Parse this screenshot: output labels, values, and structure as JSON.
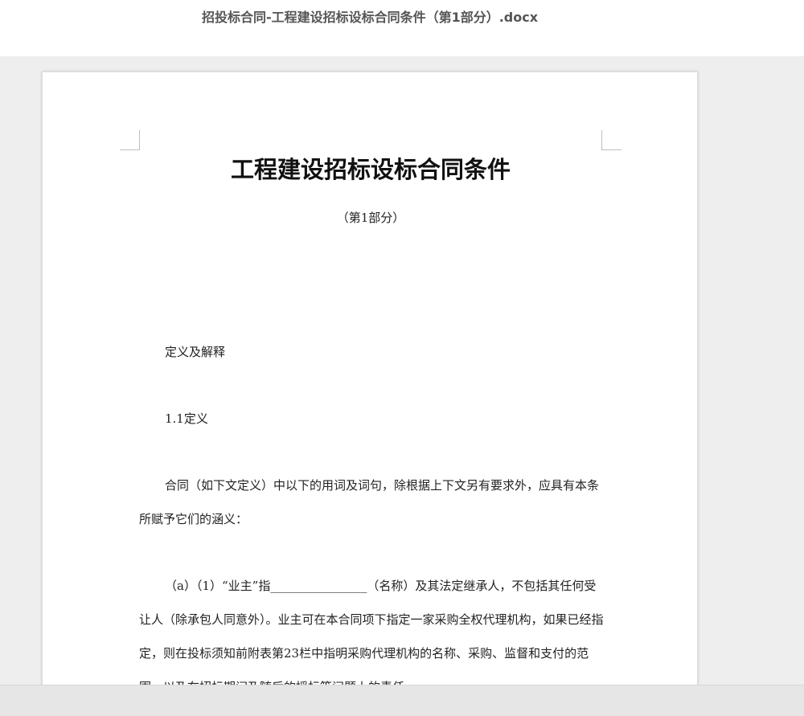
{
  "document": {
    "filename": "招投标合同-工程建设招标设标合同条件（第1部分）.docx"
  },
  "page": {
    "title": "工程建设招标设标合同条件",
    "subtitle": "（第1部分）",
    "paragraphs": [
      "定义及解释",
      "1.1定义",
      "合同（如下文定义）中以下的用词及词句，除根据上下文另有要求外，应具有本条所赋予它们的涵义：",
      "（a）（1）“业主”指________________（名称）及其法定继承人，不包括其任何受让人（除承包人同意外）。业主可在本合同项下指定一家采购全权代理机构，如果已经指定，则在投标须知前附表第23栏中指明采购代理机构的名称、采购、监督和支付的范围，以及在招标期间及随后的授标等问题上的责任。"
    ]
  }
}
